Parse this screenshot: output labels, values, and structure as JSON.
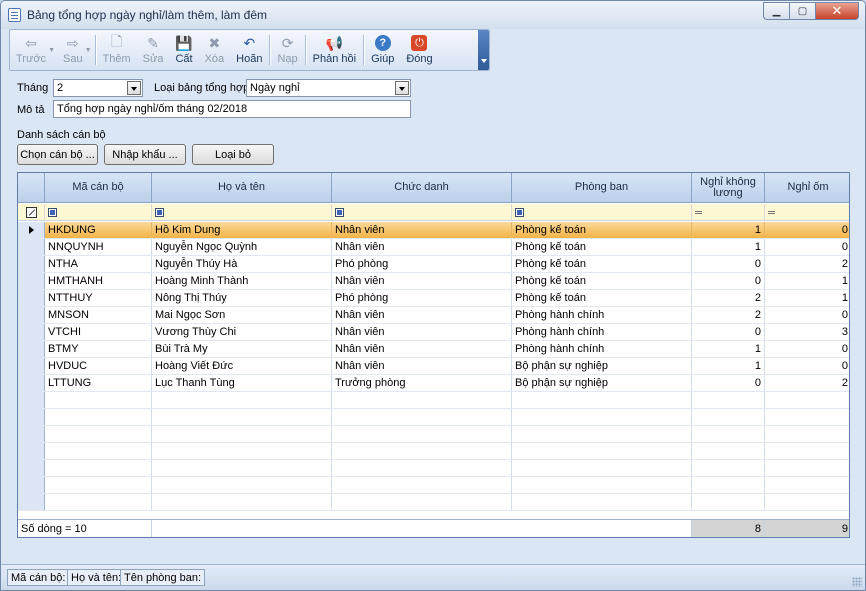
{
  "window": {
    "title": "Bảng tổng hợp ngày nghỉ/làm thêm, làm đêm"
  },
  "toolbar": {
    "back": "Trước",
    "next": "Sau",
    "add": "Thêm",
    "edit": "Sửa",
    "save": "Cất",
    "delete": "Xóa",
    "undo": "Hoãn",
    "load": "Nạp",
    "feedback": "Phản hồi",
    "help": "Giúp",
    "close": "Đóng"
  },
  "form": {
    "month_label": "Tháng",
    "month_value": "2",
    "type_label": "Loại bảng tổng hợp",
    "type_value": "Ngày nghỉ",
    "desc_label": "Mô tả",
    "desc_value": "Tổng hợp ngày nghỉ/ốm tháng 02/2018",
    "list_label": "Danh sách cán bộ",
    "btn_select": "Chọn cán bộ ...",
    "btn_import": "Nhập khẩu ...",
    "btn_remove": "Loại bỏ"
  },
  "grid": {
    "headers": [
      "Mã cán bộ",
      "Họ và tên",
      "Chức danh",
      "Phòng ban",
      "Nghỉ không lương",
      "Nghỉ ốm"
    ],
    "rows": [
      [
        "HKDUNG",
        "Hồ Kim Dung",
        "Nhân viên",
        "Phòng kế toán",
        "1",
        "0"
      ],
      [
        "NNQUYNH",
        "Nguyễn Ngọc Quỳnh",
        "Nhân viên",
        "Phòng kế toán",
        "1",
        "0"
      ],
      [
        "NTHA",
        "Nguyễn Thúy Hà",
        "Phó phòng",
        "Phòng kế toán",
        "0",
        "2"
      ],
      [
        "HMTHANH",
        "Hoàng Minh Thành",
        "Nhân viên",
        "Phòng kế toán",
        "0",
        "1"
      ],
      [
        "NTTHUY",
        "Nông Thị Thúy",
        "Phó phòng",
        "Phòng kế toán",
        "2",
        "1"
      ],
      [
        "MNSON",
        "Mai Ngọc Sơn",
        "Nhân viên",
        "Phòng hành chính",
        "2",
        "0"
      ],
      [
        "VTCHI",
        "Vương Thùy Chi",
        "Nhân viên",
        "Phòng hành chính",
        "0",
        "3"
      ],
      [
        "BTMY",
        "Bùi Trà My",
        "Nhân viên",
        "Phòng hành chính",
        "1",
        "0"
      ],
      [
        "HVDUC",
        "Hoàng Viết Đức",
        "Nhân viên",
        "Bộ phận sự nghiệp",
        "1",
        "0"
      ],
      [
        "LTTUNG",
        "Lục Thanh Tùng",
        "Trưởng phòng",
        "Bộ phận sự nghiệp",
        "0",
        "2"
      ]
    ],
    "footer_count": "Số dòng = 10",
    "footer_sum_unpaid": "8",
    "footer_sum_sick": "9"
  },
  "status": {
    "code": "Mã cán bộ:",
    "name": "Họ và tên:",
    "dept": "Tên phòng ban:"
  }
}
